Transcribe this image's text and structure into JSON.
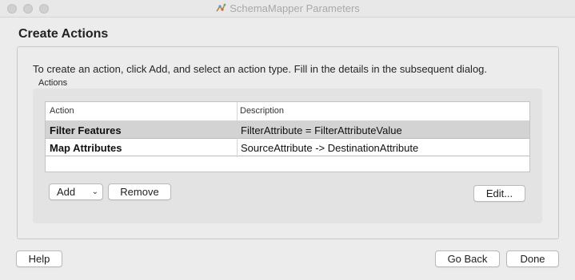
{
  "window": {
    "title": "SchemaMapper Parameters",
    "icon": "fme-app-icon"
  },
  "page": {
    "title": "Create Actions",
    "instruction": "To create an action, click Add, and select an action type. Fill in the details in the subsequent dialog.",
    "group_label": "Actions"
  },
  "table": {
    "columns": [
      "Action",
      "Description"
    ],
    "rows": [
      {
        "action": "Filter Features",
        "description": "FilterAttribute = FilterAttributeValue",
        "selected": true
      },
      {
        "action": "Map Attributes",
        "description": "SourceAttribute -> DestinationAttribute",
        "selected": false
      }
    ]
  },
  "buttons": {
    "add": "Add",
    "remove": "Remove",
    "edit": "Edit...",
    "help": "Help",
    "back": "Go Back",
    "done": "Done"
  },
  "colors": {
    "selected_row": "#d3d3d3",
    "window_bg": "#ececec"
  }
}
